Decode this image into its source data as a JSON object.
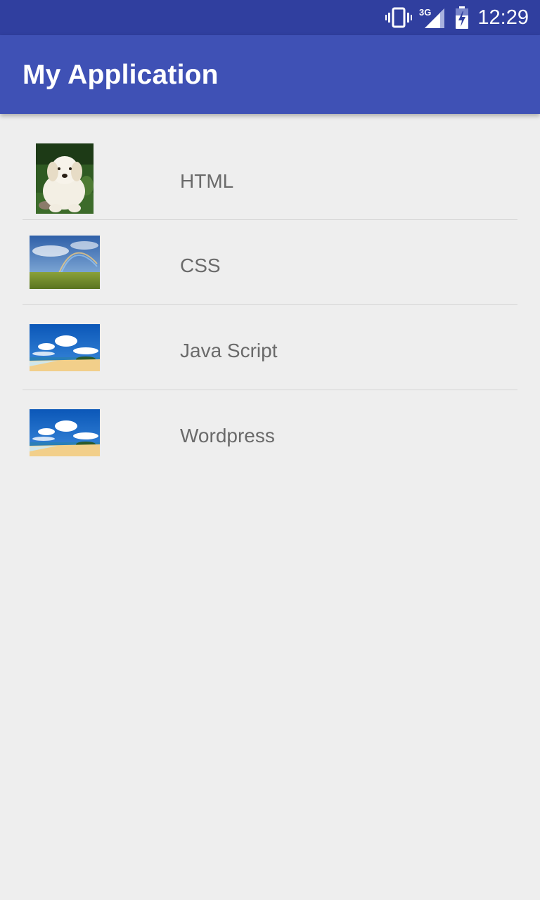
{
  "status_bar": {
    "time": "12:29",
    "network": "3G",
    "icons": [
      "vibrate-icon",
      "signal-3g-icon",
      "battery-charging-icon"
    ]
  },
  "app_bar": {
    "title": "My Application"
  },
  "list": {
    "items": [
      {
        "label": "HTML",
        "thumbnail": "puppy-image"
      },
      {
        "label": "CSS",
        "thumbnail": "rainbow-landscape-image"
      },
      {
        "label": "Java Script",
        "thumbnail": "beach-sky-image"
      },
      {
        "label": "Wordpress",
        "thumbnail": "beach-sky-image"
      }
    ]
  },
  "colors": {
    "status_bar": "#303f9f",
    "app_bar": "#3f51b5",
    "background": "#eeeeee",
    "label_text": "#6a6a6a",
    "divider": "#d4d4d4"
  }
}
